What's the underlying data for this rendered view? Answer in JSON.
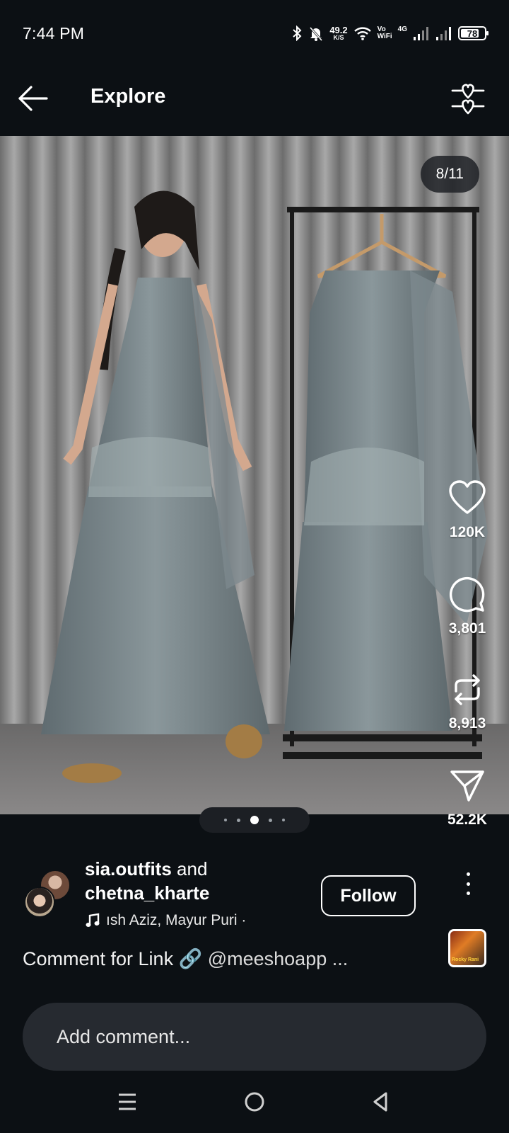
{
  "status_bar": {
    "time": "7:44 PM",
    "speed_value": "49.2",
    "speed_unit": "K/S",
    "vowifi_top": "Vo",
    "vowifi_bottom": "WiFi",
    "network": "4G",
    "battery": "78"
  },
  "header": {
    "title": "Explore",
    "back_icon": "arrow-left-icon",
    "filter_icon": "heart-sliders-icon"
  },
  "post": {
    "image_counter": "8/11",
    "carousel_dots": 5,
    "active_dot": 2
  },
  "actions": {
    "likes": "120K",
    "comments": "3,801",
    "reposts": "8,913",
    "shares": "52.2K"
  },
  "author": {
    "user1": "sia.outfits",
    "joiner": "and",
    "user2": "chetna_kharte",
    "audio": "ısh Aziz, Mayur Puri ·",
    "follow_label": "Follow"
  },
  "music_thumb": {
    "text": "Rocky Rani"
  },
  "caption": {
    "text": "Comment for Link 🔗",
    "mention": "@meeshoapp ..."
  },
  "comment": {
    "placeholder": "Add comment..."
  },
  "colors": {
    "background": "#0c1014",
    "surface": "#262a30",
    "text": "#ffffff"
  }
}
